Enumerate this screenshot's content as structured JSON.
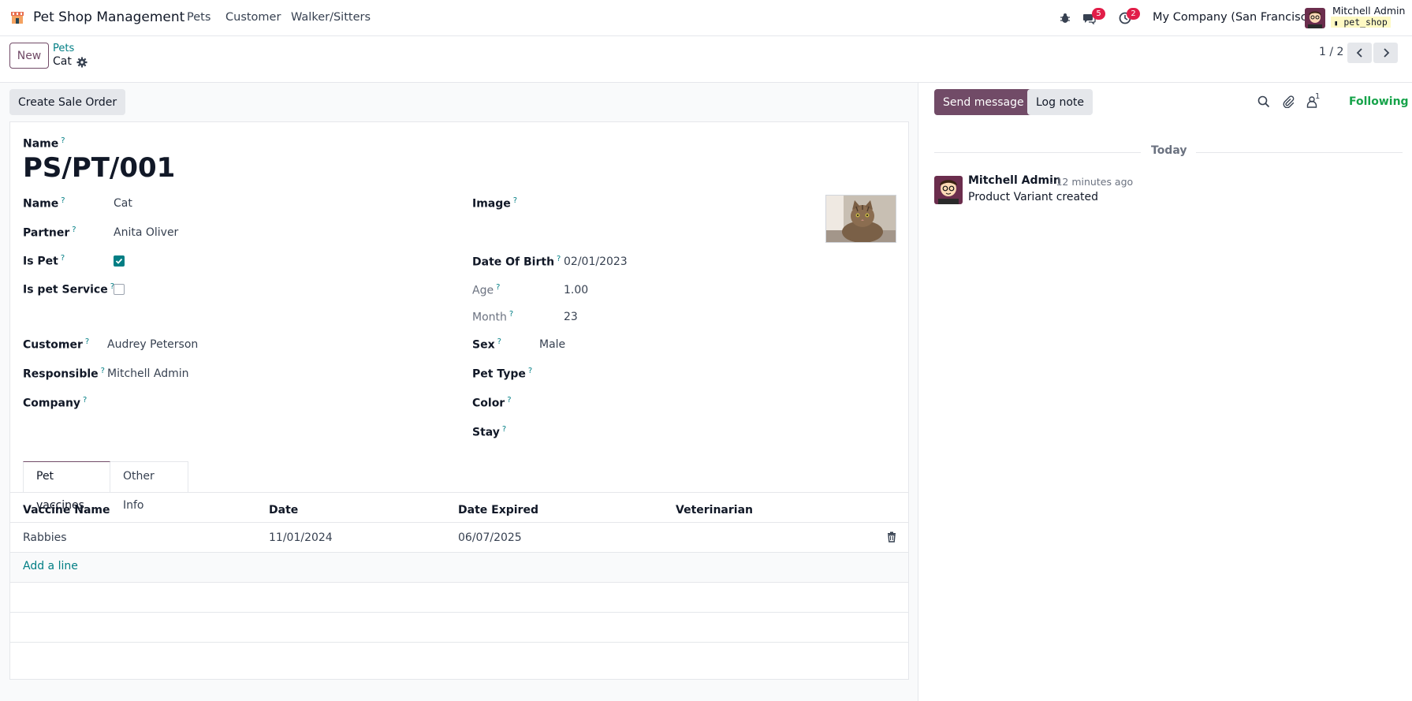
{
  "navbar": {
    "app_icon": "pet-shop-icon",
    "app_title": "Pet Shop Management",
    "menu": [
      "Pets",
      "Customer",
      "Walker/Sitters"
    ],
    "messages_badge": "5",
    "activities_badge": "2",
    "company": "My Company (San Francisco)",
    "user_name": "Mitchell Admin",
    "database": "pet_shop"
  },
  "control": {
    "new_label": "New",
    "breadcrumb_parent": "Pets",
    "breadcrumb_current": "Cat",
    "pager": "1 / 2"
  },
  "form": {
    "action_button": "Create Sale Order",
    "name_label_top": "Name",
    "title": "PS/PT/001",
    "left_fields": [
      {
        "label": "Name",
        "value": "Cat"
      },
      {
        "label": "Partner",
        "value": "Anita Oliver"
      },
      {
        "label": "Is Pet",
        "checked": true
      },
      {
        "label": "Is pet Service",
        "checked": false
      },
      {
        "label": "Customer",
        "value": "Audrey Peterson"
      },
      {
        "label": "Responsible",
        "value": "Mitchell Admin"
      },
      {
        "label": "Company",
        "value": ""
      }
    ],
    "right_fields": [
      {
        "label": "Image"
      },
      {
        "label": "Date Of Birth",
        "value": "02/01/2023"
      },
      {
        "label": "Age",
        "value": "1.00"
      },
      {
        "label": "Month",
        "value": "23"
      },
      {
        "label": "Sex",
        "value": "Male"
      },
      {
        "label": "Pet Type",
        "value": ""
      },
      {
        "label": "Color",
        "value": ""
      },
      {
        "label": "Stay",
        "value": ""
      }
    ],
    "help_mark": "?",
    "tabs": [
      "Pet vaccines",
      "Other Info"
    ],
    "table": {
      "columns": [
        "Vaccine Name",
        "Date",
        "Date Expired",
        "Veterinarian"
      ],
      "rows": [
        {
          "vaccine": "Rabbies",
          "date": "11/01/2024",
          "expired": "06/07/2025",
          "vet": ""
        }
      ],
      "add_line": "Add a line"
    }
  },
  "chatter": {
    "send_message": "Send message",
    "log_note": "Log note",
    "followers_count": "1",
    "following": "Following",
    "separator": "Today",
    "messages": [
      {
        "author": "Mitchell Admin",
        "time": "- 12 minutes ago",
        "body": "Product Variant created"
      }
    ]
  },
  "colors": {
    "brand": "#714b67",
    "accent": "#017e84",
    "following": "#16a34a",
    "badge": "#e11d48"
  }
}
